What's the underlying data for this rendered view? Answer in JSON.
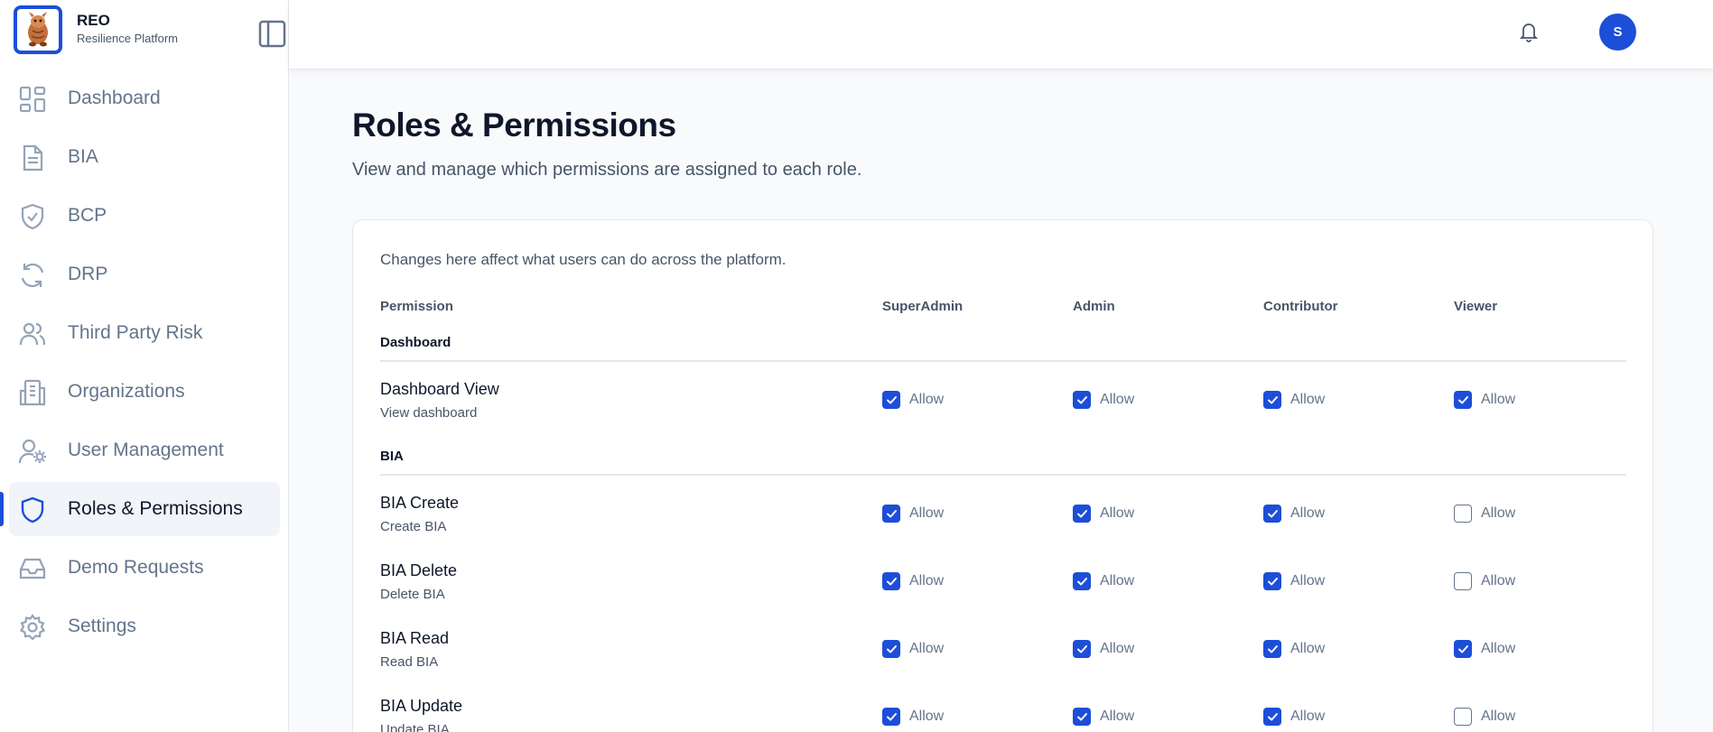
{
  "brand": {
    "name": "REO",
    "subtitle": "Resilience Platform"
  },
  "sidebar": {
    "items": [
      {
        "label": "Dashboard",
        "icon": "dashboard-grid-icon",
        "active": false
      },
      {
        "label": "BIA",
        "icon": "document-icon",
        "active": false
      },
      {
        "label": "BCP",
        "icon": "shield-check-icon",
        "active": false
      },
      {
        "label": "DRP",
        "icon": "refresh-icon",
        "active": false
      },
      {
        "label": "Third Party Risk",
        "icon": "users-icon",
        "active": false
      },
      {
        "label": "Organizations",
        "icon": "building-icon",
        "active": false
      },
      {
        "label": "User Management",
        "icon": "user-cog-icon",
        "active": false
      },
      {
        "label": "Roles & Permissions",
        "icon": "shield-icon",
        "active": true
      },
      {
        "label": "Demo Requests",
        "icon": "inbox-icon",
        "active": false
      },
      {
        "label": "Settings",
        "icon": "gear-icon",
        "active": false
      }
    ]
  },
  "header": {
    "avatar_initial": "S"
  },
  "main": {
    "title": "Roles & Permissions",
    "subtitle": "View and manage which permissions are assigned to each role.",
    "note": "Changes here affect what users can do across the platform.",
    "columns": [
      "Permission",
      "SuperAdmin",
      "Admin",
      "Contributor",
      "Viewer"
    ],
    "allow_label": "Allow",
    "sections": [
      {
        "label": "Dashboard",
        "rows": [
          {
            "name": "Dashboard View",
            "desc": "View dashboard",
            "values": [
              true,
              true,
              true,
              true
            ]
          }
        ]
      },
      {
        "label": "BIA",
        "rows": [
          {
            "name": "BIA Create",
            "desc": "Create BIA",
            "values": [
              true,
              true,
              true,
              false
            ]
          },
          {
            "name": "BIA Delete",
            "desc": "Delete BIA",
            "values": [
              true,
              true,
              true,
              false
            ]
          },
          {
            "name": "BIA Read",
            "desc": "Read BIA",
            "values": [
              true,
              true,
              true,
              true
            ]
          },
          {
            "name": "BIA Update",
            "desc": "Update BIA",
            "values": [
              true,
              true,
              true,
              false
            ]
          }
        ]
      }
    ]
  },
  "colors": {
    "accent": "#1d4ed8",
    "muted": "#64748b",
    "text": "#0f172a"
  }
}
